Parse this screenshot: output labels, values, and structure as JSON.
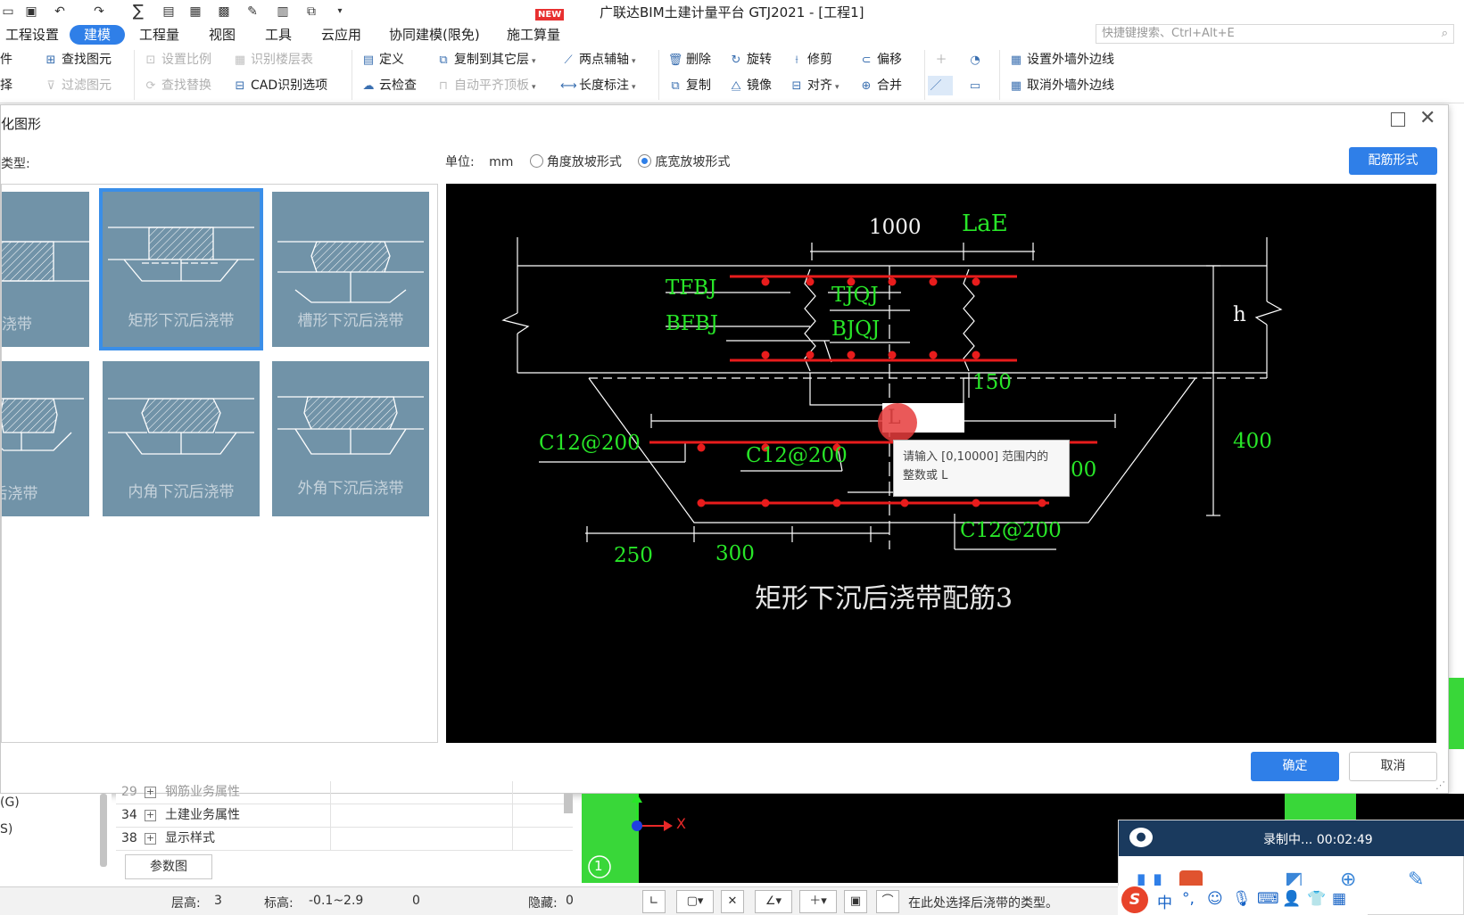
{
  "window": {
    "app_title": "广联达BIM土建计量平台 GTJ2021 - [工程1]",
    "new_badge": "NEW"
  },
  "quick_access": [
    {
      "icon": "folder-icon"
    },
    {
      "icon": "save-icon"
    },
    {
      "icon": "undo-icon"
    },
    {
      "icon": "redo-icon"
    },
    {
      "icon": "sum-icon"
    },
    {
      "icon": "report-icon"
    },
    {
      "icon": "table-icon"
    },
    {
      "icon": "grid-icon"
    },
    {
      "icon": "edit-icon"
    },
    {
      "icon": "layers-icon"
    },
    {
      "icon": "copy-icon"
    },
    {
      "icon": "customize-icon"
    }
  ],
  "menu": {
    "items": [
      "工程设置",
      "建模",
      "工程量",
      "视图",
      "工具",
      "云应用",
      "协同建模(限免)",
      "施工算量"
    ],
    "active": "建模",
    "search_placeholder": "快捷键搜索、Ctrl+Alt+E"
  },
  "ribbon": {
    "group1": {
      "row1": "件",
      "row2": "择"
    },
    "group2": {
      "find_element": "查找图元",
      "filter_element": "过滤图元"
    },
    "group3": {
      "set_scale": "设置比例",
      "recognize_floors": "识别楼层表",
      "find_replace": "查找替换",
      "cad_options": "CAD识别选项"
    },
    "group4": {
      "define": "定义",
      "copy_to_other_floor": "复制到其它层",
      "two_point_axis": "两点辅轴",
      "cloud_check": "云检查",
      "auto_flush_slab": "自动平齐顶板",
      "length_dim": "长度标注"
    },
    "group5": {
      "delete": "删除",
      "rotate": "旋转",
      "trim": "修剪",
      "offset": "偏移",
      "copy": "复制",
      "mirror": "镜像",
      "align": "对齐",
      "merge": "合并"
    },
    "group7": {
      "set_outer_edge": "设置外墙外边线",
      "cancel_outer_edge": "取消外墙外边线"
    }
  },
  "dialog": {
    "title": "化图形",
    "type_label": "类型:",
    "unit_label": "单位:",
    "unit_value": "mm",
    "radio_angle": "角度放坡形式",
    "radio_bottom": "底宽放坡形式",
    "selected_radio": "bottom",
    "rebar_button": "配筋形式",
    "ok_button": "确定",
    "cancel_button": "取消",
    "tiles": [
      {
        "label": "形后浇带",
        "selected": false
      },
      {
        "label": "矩形下沉后浇带",
        "selected": true
      },
      {
        "label": "槽形下沉后浇带",
        "selected": false
      },
      {
        "label": "下沉后浇带",
        "selected": false
      },
      {
        "label": "内角下沉后浇带",
        "selected": false
      },
      {
        "label": "外角下沉后浇带",
        "selected": false
      }
    ]
  },
  "drawing": {
    "labels": {
      "dim_1000": "1000",
      "lae": "LaE",
      "tfbj": "TFBJ",
      "tjqj": "TJQJ",
      "bfbj": "BFBJ",
      "bjqj": "BJQJ",
      "h": "h",
      "dim_150": "150",
      "c12_left": "C12@200",
      "c12_mid": "C12@200",
      "dim_400": "400",
      "partial_00": "00",
      "c12_bottom": "C12@200",
      "dim_250": "250",
      "dim_300": "300"
    },
    "caption": "矩形下沉后浇带配筋3",
    "input_value": "L",
    "tooltip": "请输入 [0,10000] 范围内的整数或 L"
  },
  "left_tree": {
    "items": [
      "(G)",
      "S)"
    ]
  },
  "properties": {
    "rows": [
      {
        "num": "29",
        "name": "钢筋业务属性"
      },
      {
        "num": "34",
        "name": "土建业务属性"
      },
      {
        "num": "38",
        "name": "显示样式"
      }
    ],
    "param_button": "参数图"
  },
  "viewport": {
    "axis_number": "1",
    "x_axis_label": "X"
  },
  "statusbar": {
    "floor_height_label": "层高:",
    "floor_height_value": "3",
    "elevation_label": "标高:",
    "elevation_value": "-0.1~2.9",
    "count_value": "0",
    "hidden_label": "隐藏:",
    "hidden_value": "0",
    "hint": "在此处选择后浇带的类型。"
  },
  "recorder": {
    "status": "录制中...",
    "time": "00:02:49"
  },
  "ime": {
    "mode": "中"
  }
}
